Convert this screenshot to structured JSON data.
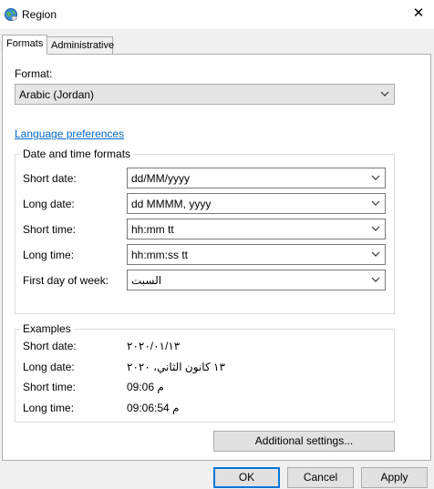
{
  "window": {
    "title": "Region",
    "app_icon": "globe-icon",
    "close_glyph": "✕"
  },
  "tabs": [
    {
      "label": "Formats",
      "selected": true
    },
    {
      "label": "Administrative",
      "selected": false
    }
  ],
  "format": {
    "label": "Format:",
    "value": "Arabic (Jordan)"
  },
  "language_link": "Language preferences",
  "date_time_group": {
    "title": "Date and time formats",
    "rows": [
      {
        "label": "Short date:",
        "value": "dd/MM/yyyy"
      },
      {
        "label": "Long date:",
        "value": "dd MMMM, yyyy"
      },
      {
        "label": "Short time:",
        "value": "hh:mm tt"
      },
      {
        "label": "Long time:",
        "value": "hh:mm:ss tt"
      },
      {
        "label": "First day of week:",
        "value": "السبت"
      }
    ]
  },
  "examples": {
    "title": "Examples",
    "rows": [
      {
        "label": "Short date:",
        "value": "٢٠٢٠/٠١/١٣"
      },
      {
        "label": "Long date:",
        "value": "١٣ كانون الثاني، ٢٠٢٠"
      },
      {
        "label": "Short time:",
        "value": "09:06 م"
      },
      {
        "label": "Long time:",
        "value": "09:06:54 م"
      }
    ]
  },
  "additional_settings_label": "Additional settings...",
  "buttons": {
    "ok": "OK",
    "cancel": "Cancel",
    "apply": "Apply"
  },
  "colors": {
    "link": "#0066cc",
    "default_button_border": "#0078d7"
  }
}
